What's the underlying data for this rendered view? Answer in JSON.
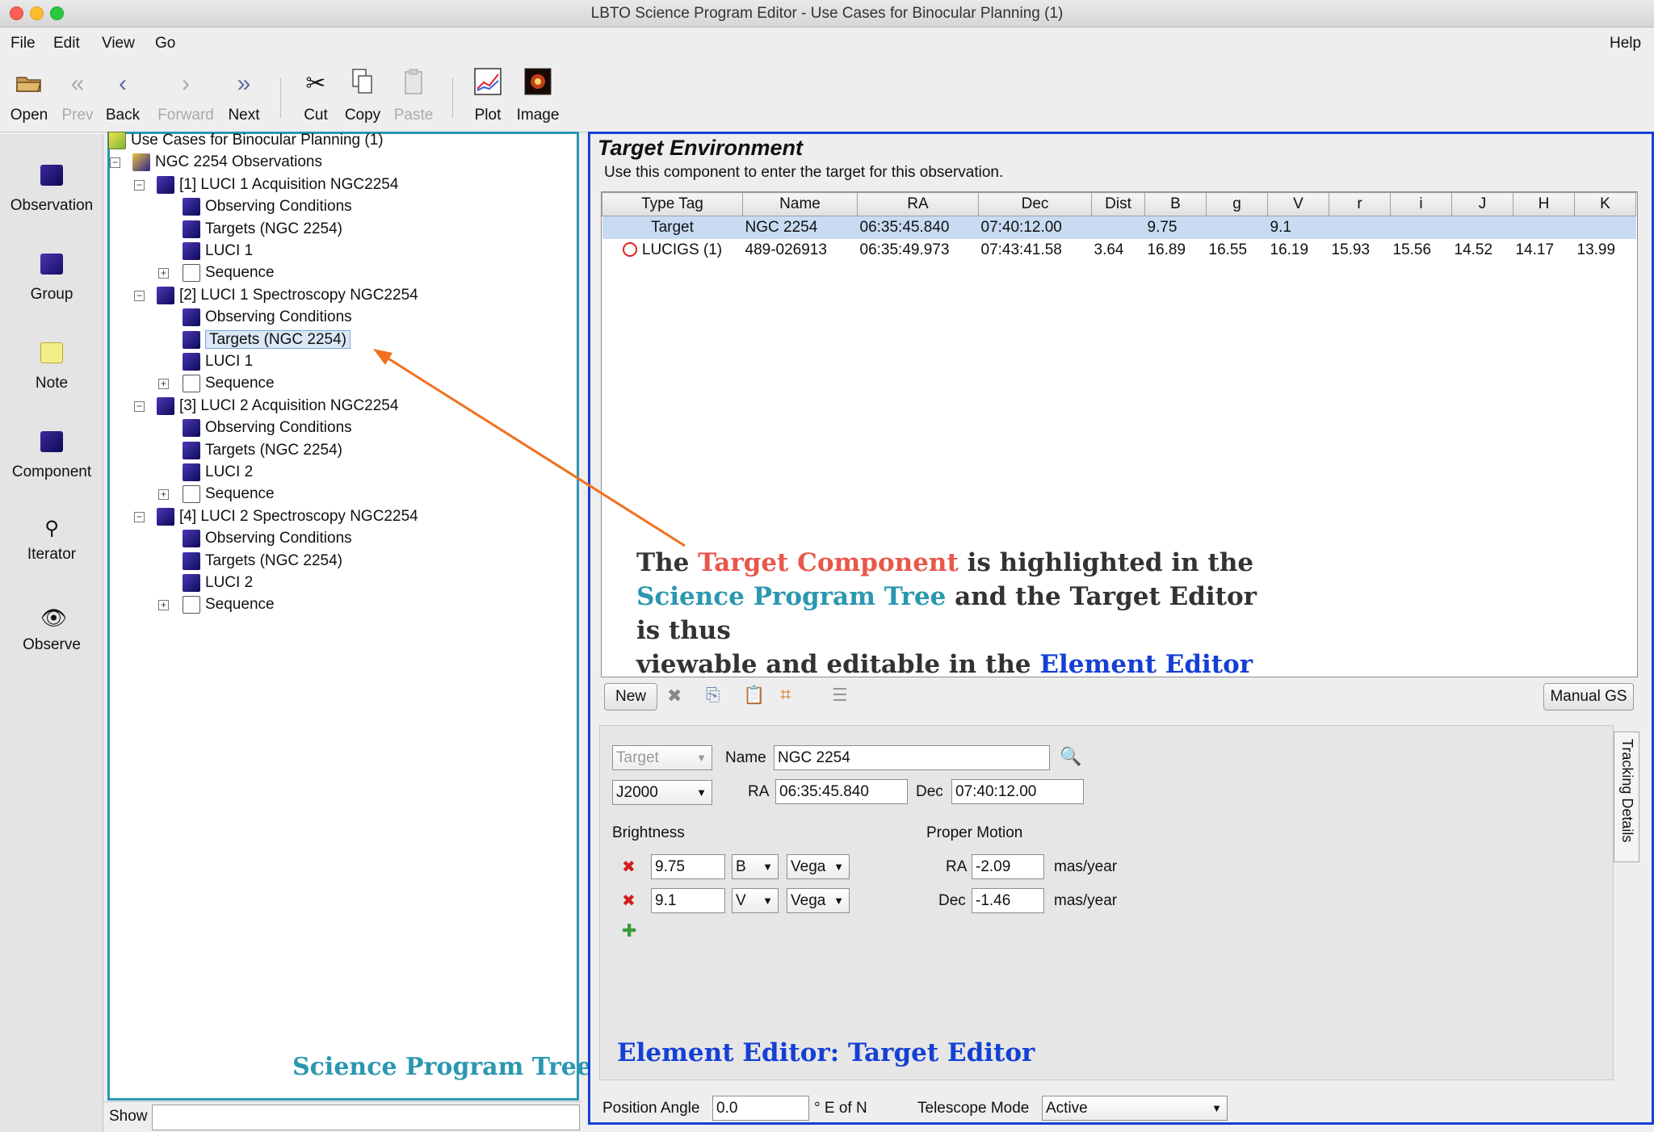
{
  "window": {
    "title": "LBTO Science Program Editor - Use Cases for Binocular Planning (1)"
  },
  "menu": {
    "file": "File",
    "edit": "Edit",
    "view": "View",
    "go": "Go",
    "help": "Help"
  },
  "toolbar": {
    "open": "Open",
    "prev": "Prev",
    "back": "Back",
    "forward": "Forward",
    "next": "Next",
    "cut": "Cut",
    "copy": "Copy",
    "paste": "Paste",
    "plot": "Plot",
    "image": "Image"
  },
  "palette": {
    "observation": "Observation",
    "group": "Group",
    "note": "Note",
    "component": "Component",
    "iterator": "Iterator",
    "observe": "Observe"
  },
  "tree": {
    "root": "Use Cases for Binocular Planning (1)",
    "group": "NGC 2254 Observations",
    "obs": [
      {
        "title": "[1] LUCI 1 Acquisition NGC2254",
        "cond": "Observing Conditions",
        "targets": "Targets (NGC 2254)",
        "inst": "LUCI 1",
        "seq": "Sequence"
      },
      {
        "title": "[2] LUCI 1 Spectroscopy NGC2254",
        "cond": "Observing Conditions",
        "targets": "Targets (NGC 2254)",
        "inst": "LUCI 1",
        "seq": "Sequence"
      },
      {
        "title": "[3] LUCI 2 Acquisition NGC2254",
        "cond": "Observing Conditions",
        "targets": "Targets (NGC 2254)",
        "inst": "LUCI 2",
        "seq": "Sequence"
      },
      {
        "title": "[4] LUCI 2 Spectroscopy NGC2254",
        "cond": "Observing Conditions",
        "targets": "Targets (NGC 2254)",
        "inst": "LUCI 2",
        "seq": "Sequence"
      }
    ],
    "caption": "Science Program Tree",
    "show_label": "Show"
  },
  "env": {
    "title": "Target Environment",
    "subtitle": "Use this component to enter the target for this observation.",
    "columns": [
      "Type Tag",
      "Name",
      "RA",
      "Dec",
      "Dist",
      "B",
      "g",
      "V",
      "r",
      "i",
      "J",
      "H",
      "K"
    ],
    "rows": [
      [
        "Target",
        "NGC 2254",
        "06:35:45.840",
        "07:40:12.00",
        "",
        "9.75",
        "",
        "9.1",
        "",
        "",
        "",
        "",
        ""
      ],
      [
        "LUCIGS (1)",
        "489-026913",
        "06:35:49.973",
        "07:43:41.58",
        "3.64",
        "16.89",
        "16.55",
        "16.19",
        "15.93",
        "15.56",
        "14.52",
        "14.17",
        "13.99"
      ]
    ],
    "new_button": "New",
    "manual_gs": "Manual GS"
  },
  "annotation": {
    "part1": "The ",
    "part2": "Target Component",
    "part3": " is highlighted in the",
    "part4": "Science Program Tree",
    "part5": " and the Target Editor is thus",
    "part6": "viewable and editable in the ",
    "part7": "Element Editor"
  },
  "form": {
    "tag": "Target",
    "name_label": "Name",
    "name": "NGC 2254",
    "epoch": "J2000",
    "ra_label": "RA",
    "ra": "06:35:45.840",
    "dec_label": "Dec",
    "dec": "07:40:12.00",
    "brightness_label": "Brightness",
    "brightness": [
      {
        "value": "9.75",
        "band": "B",
        "system": "Vega"
      },
      {
        "value": "9.1",
        "band": "V",
        "system": "Vega"
      }
    ],
    "pm_label": "Proper Motion",
    "pm_ra_label": "RA",
    "pm_ra": "-2.09",
    "pm_dec_label": "Dec",
    "pm_dec": "-1.46",
    "pm_unit": "mas/year",
    "tracking_tab": "Tracking Details",
    "pa_label": "Position Angle",
    "pa": "0.0",
    "pa_unit": "° E of N",
    "tel_mode_label": "Telescope Mode",
    "tel_mode": "Active"
  },
  "editor_caption": "Element Editor: Target Editor",
  "colors": {
    "tree_border": "#2b97b0",
    "editor_border": "#1540d4",
    "arrow": "#f07020",
    "highlight_red": "#e8574a"
  }
}
